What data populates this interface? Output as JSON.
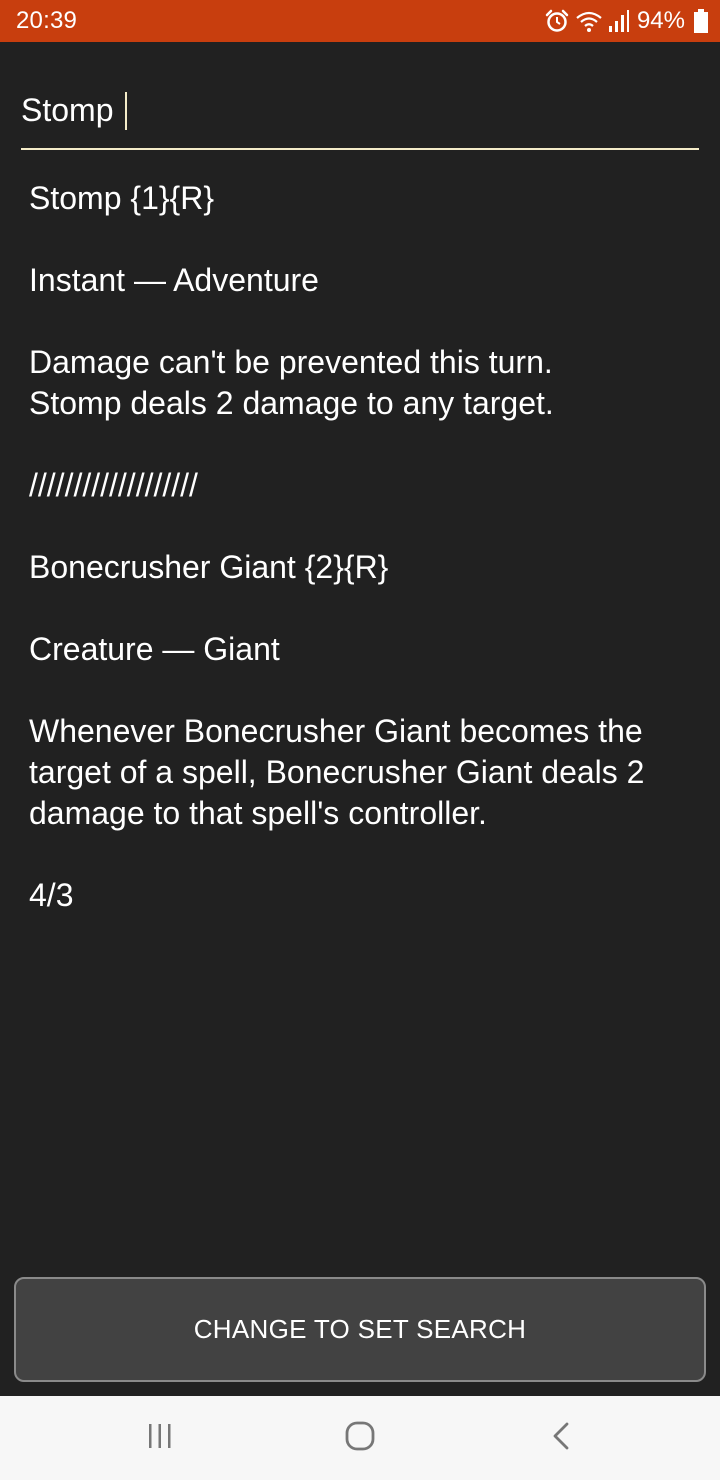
{
  "status_bar": {
    "time": "20:39",
    "battery": "94%",
    "icons": [
      "alarm-icon",
      "wifi-icon",
      "signal-icon",
      "battery-icon"
    ]
  },
  "search": {
    "value": "Stomp"
  },
  "card": {
    "paragraphs": [
      "Stomp {1}{R}",
      "Instant — Adventure",
      "Damage can't be prevented this turn.\nStomp deals 2 damage to any target.",
      "///////////////////",
      "Bonecrusher Giant {2}{R}",
      "Creature — Giant",
      "Whenever Bonecrusher Giant becomes the target of a spell, Bonecrusher Giant deals 2 damage to that spell's controller.",
      "4/3"
    ]
  },
  "set_search_button": {
    "label": "CHANGE TO SET SEARCH"
  },
  "nav_bar": {
    "icons": [
      "recent-apps-icon",
      "home-icon",
      "back-icon"
    ]
  },
  "colors": {
    "status_bar": "#c83e0e",
    "background": "#212121",
    "underline_accent": "#f4ecc8",
    "button_bg": "#424242",
    "nav_bg": "#f7f7f7"
  }
}
